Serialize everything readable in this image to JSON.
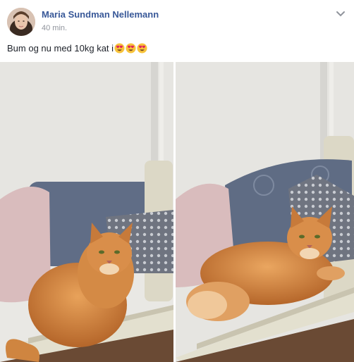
{
  "post": {
    "author": "Maria Sundman Nellemann",
    "timestamp": "40 min.",
    "text": "Bum og nu med 10kg kat i",
    "emojis": [
      "heart-eyes-icon",
      "heart-eyes-icon",
      "heart-eyes-icon"
    ],
    "photos": [
      {
        "subject": "orange-cat-sitting"
      },
      {
        "subject": "orange-cat-lying"
      }
    ]
  },
  "colors": {
    "author": "#385898",
    "timestamp": "#90949c",
    "text": "#1d2129"
  }
}
